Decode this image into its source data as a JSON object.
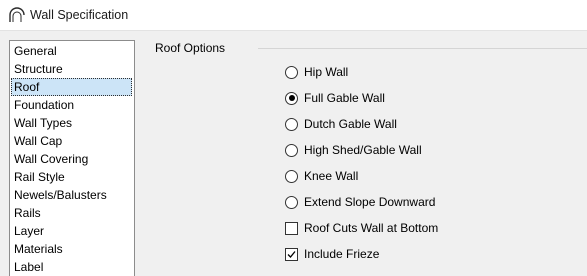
{
  "window": {
    "title": "Wall Specification",
    "icon": "arch-wall-icon"
  },
  "categories": {
    "items": [
      {
        "label": "General",
        "selected": false
      },
      {
        "label": "Structure",
        "selected": false
      },
      {
        "label": "Roof",
        "selected": true
      },
      {
        "label": "Foundation",
        "selected": false
      },
      {
        "label": "Wall Types",
        "selected": false
      },
      {
        "label": "Wall Cap",
        "selected": false
      },
      {
        "label": "Wall Covering",
        "selected": false
      },
      {
        "label": "Rail Style",
        "selected": false
      },
      {
        "label": "Newels/Balusters",
        "selected": false
      },
      {
        "label": "Rails",
        "selected": false
      },
      {
        "label": "Layer",
        "selected": false
      },
      {
        "label": "Materials",
        "selected": false
      },
      {
        "label": "Label",
        "selected": false
      }
    ]
  },
  "roof_options": {
    "group_label": "Roof Options",
    "radios": [
      {
        "label": "Hip Wall",
        "checked": false
      },
      {
        "label": "Full Gable Wall",
        "checked": true
      },
      {
        "label": "Dutch Gable Wall",
        "checked": false
      },
      {
        "label": "High Shed/Gable Wall",
        "checked": false
      },
      {
        "label": "Knee Wall",
        "checked": false
      },
      {
        "label": "Extend Slope Downward",
        "checked": false
      }
    ],
    "checkboxes": [
      {
        "label": "Roof Cuts Wall at Bottom",
        "checked": false
      },
      {
        "label": "Include Frieze",
        "checked": true
      }
    ]
  },
  "colors": {
    "selection": "#cce4f7",
    "dialog_background": "#f0f0f0"
  }
}
